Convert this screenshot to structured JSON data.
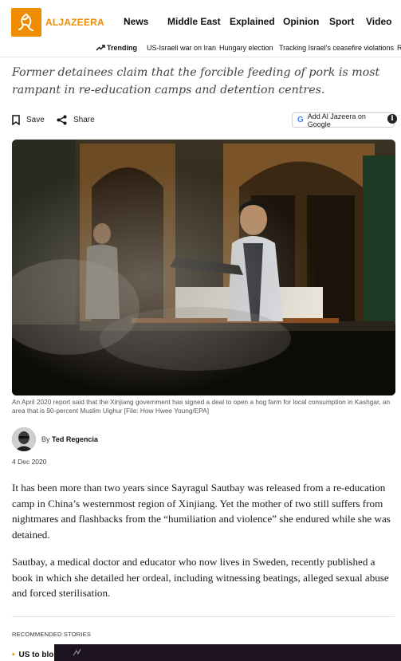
{
  "header": {
    "logo_text": "ALJAZEERA",
    "brand_color": "#f08c00",
    "nav": [
      {
        "label": "News",
        "has_dropdown": true
      },
      {
        "label": "Middle East"
      },
      {
        "label": "Explained"
      },
      {
        "label": "Opinion"
      },
      {
        "label": "Sport"
      },
      {
        "label": "Video"
      }
    ]
  },
  "trending": {
    "label": "Trending",
    "items": [
      "US-Israeli war on Iran",
      "Hungary election",
      "Tracking Israel's ceasefire violations",
      "R"
    ]
  },
  "article": {
    "subhead": "Former detainees claim that the forcible feeding of pork is most rampant in re-education camps and detention centres.",
    "actions": {
      "save_label": "Save",
      "share_label": "Share",
      "google_label": "Add Al Jazeera on Google"
    },
    "image_caption": "An April 2020 report said that the Xinjiang government has signed a deal to open a hog farm for local consumption in Kashgar, an area that is 90-percent Muslim Uighur [File: How Hwee Young/EPA]",
    "author": {
      "by": "By",
      "name": "Ted Regencia"
    },
    "date": "4 Dec 2020",
    "paragraphs": [
      "It has been more than two years since Sayragul Sautbay was released from a re-education camp in China’s westernmost region of Xinjiang. Yet the mother of two still suffers from nightmares and flashbacks from the “humiliation and violence” she endured while she was detained.",
      "Sautbay, a medical doctor and educator who now lives in Sweden, recently published a book in which she detailed her ordeal, including witnessing beatings, alleged sexual abuse and forced sterilisation."
    ]
  },
  "recommended": {
    "title": "RECOMMENDED STORIES",
    "first_item": "US to blo"
  }
}
